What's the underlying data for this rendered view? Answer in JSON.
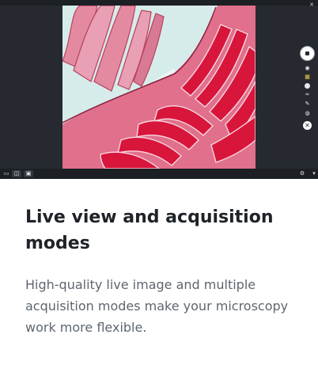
{
  "card": {
    "title": "Live view and acquisition modes",
    "description": "High-quality live image and multiple acquisition modes make your microscopy work more flexible."
  },
  "app": {
    "live_view": {
      "subject": "stained tissue section (micrograph)"
    },
    "right_toolbar": {
      "icons": [
        "capture-icon",
        "camera-icon",
        "grid-icon",
        "settings-icon",
        "link-icon",
        "pencil-icon",
        "eye-icon",
        "close-icon"
      ]
    },
    "bottom_bar": {
      "left_icons": [
        "screen-icon",
        "layers-icon",
        "window-icon"
      ],
      "right_icons": [
        "cog-icon",
        "filter-icon"
      ]
    }
  },
  "colors": {
    "app_background": "#262a30",
    "bar_background": "#1c1f24",
    "title_text": "#1f2328",
    "body_text": "#5e6670",
    "tissue_pink": "#e06a86",
    "tissue_red": "#d8153a",
    "background_cyan": "#d5ecea"
  }
}
